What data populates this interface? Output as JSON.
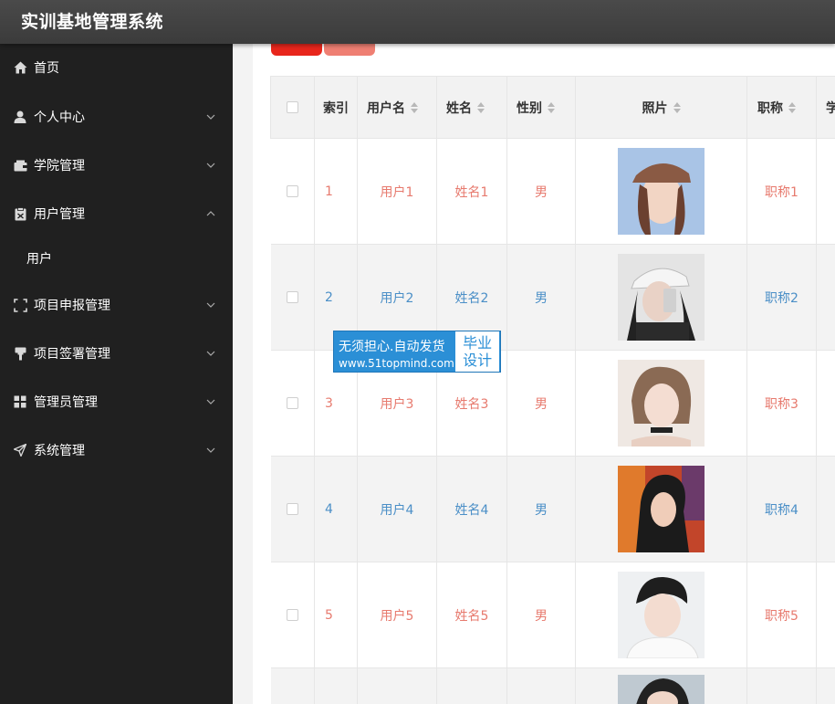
{
  "app": {
    "title": "实训基地管理系统"
  },
  "sidebar": {
    "items": [
      {
        "label": "首页",
        "icon": "home-icon"
      },
      {
        "label": "个人中心",
        "icon": "user-icon"
      },
      {
        "label": "学院管理",
        "icon": "wallet-icon"
      },
      {
        "label": "用户管理",
        "icon": "clipboard-icon"
      },
      {
        "label": "项目申报管理",
        "icon": "scan-icon"
      },
      {
        "label": "项目签署管理",
        "icon": "stamp-icon"
      },
      {
        "label": "管理员管理",
        "icon": "grid-icon"
      },
      {
        "label": "系统管理",
        "icon": "send-icon"
      }
    ],
    "sub_item": "用户"
  },
  "table": {
    "headers": {
      "index": "索引",
      "username": "用户名",
      "name": "姓名",
      "gender": "性别",
      "photo": "照片",
      "title": "职称",
      "more": "学"
    },
    "rows": [
      {
        "index": "1",
        "username": "用户1",
        "name": "姓名1",
        "gender": "男",
        "title": "职称1"
      },
      {
        "index": "2",
        "username": "用户2",
        "name": "姓名2",
        "gender": "男",
        "title": "职称2"
      },
      {
        "index": "3",
        "username": "用户3",
        "name": "姓名3",
        "gender": "男",
        "title": "职称3"
      },
      {
        "index": "4",
        "username": "用户4",
        "name": "姓名4",
        "gender": "男",
        "title": "职称4"
      },
      {
        "index": "5",
        "username": "用户5",
        "name": "姓名5",
        "gender": "男",
        "title": "职称5"
      }
    ]
  },
  "watermark": {
    "line1": "无须担心.自动发货",
    "line2": "www.51topmind.com",
    "right1": "毕业",
    "right2": "设计"
  },
  "colors": {
    "sidebar_bg": "#202020",
    "topbar_bg": "#404040",
    "accent_red": "#e77a6e",
    "accent_blue": "#4b8fc7",
    "button_red": "#e8261c",
    "button_pink": "#ef7f73"
  }
}
